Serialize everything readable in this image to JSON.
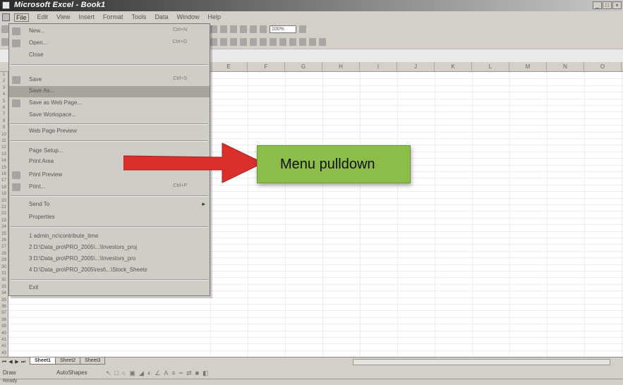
{
  "window": {
    "title": "Microsoft Excel - Book1"
  },
  "menubar": {
    "items": [
      "File",
      "Edit",
      "View",
      "Insert",
      "Format",
      "Tools",
      "Data",
      "Window",
      "Help"
    ]
  },
  "toolbar": {
    "zoom": "100%"
  },
  "columns": [
    "E",
    "F",
    "G",
    "H",
    "I",
    "J",
    "K",
    "L",
    "M",
    "N",
    "O"
  ],
  "rows": [
    "1",
    "2",
    "3",
    "4",
    "5",
    "6",
    "7",
    "8",
    "9",
    "10",
    "11",
    "12",
    "13",
    "14",
    "15",
    "16",
    "17",
    "18",
    "19",
    "20",
    "21",
    "22",
    "23",
    "24",
    "25",
    "26",
    "27",
    "28",
    "29",
    "30",
    "31",
    "32",
    "33",
    "34",
    "35",
    "36",
    "37",
    "38",
    "39",
    "40",
    "41",
    "42",
    "43"
  ],
  "file_menu": {
    "items": [
      {
        "label": "New...",
        "shortcut": "Ctrl+N",
        "icon": "new-document-icon"
      },
      {
        "label": "Open...",
        "shortcut": "Ctrl+O",
        "icon": "open-folder-icon"
      },
      {
        "label": "Close"
      },
      {
        "label": "Save",
        "shortcut": "Ctrl+S",
        "icon": "save-disk-icon"
      },
      {
        "label": "Save As..."
      },
      {
        "label": "Save as Web Page...",
        "icon": "web-page-icon"
      },
      {
        "label": "Save Workspace..."
      },
      {
        "label": "Web Page Preview"
      },
      {
        "label": "Page Setup..."
      },
      {
        "label": "Print Area"
      },
      {
        "label": "Print Preview",
        "icon": "print-preview-icon"
      },
      {
        "label": "Print...",
        "shortcut": "Ctrl+P",
        "icon": "printer-icon"
      },
      {
        "label": "Send To"
      },
      {
        "label": "Properties"
      },
      {
        "label": "1 admin_nc\\contribute_time"
      },
      {
        "label": "2 D:\\Data_pro\\PRO_2005\\...\\Investors_proj"
      },
      {
        "label": "3 D:\\Data_pro\\PRO_2005\\...\\Investors_pro"
      },
      {
        "label": "4 D:\\Data_pro\\PRO_2005\\rest\\...\\Stock_Sheets"
      },
      {
        "label": "Exit"
      }
    ]
  },
  "sheet_tabs": [
    "Sheet1",
    "Sheet2",
    "Sheet3"
  ],
  "drawing": {
    "draw_label": "Draw",
    "autoshapes_label": "AutoShapes"
  },
  "status": {
    "text": "Ready"
  },
  "annotation": {
    "text": "Menu pulldown",
    "color": "#8cbc4a",
    "arrow_color": "#d9302b"
  }
}
